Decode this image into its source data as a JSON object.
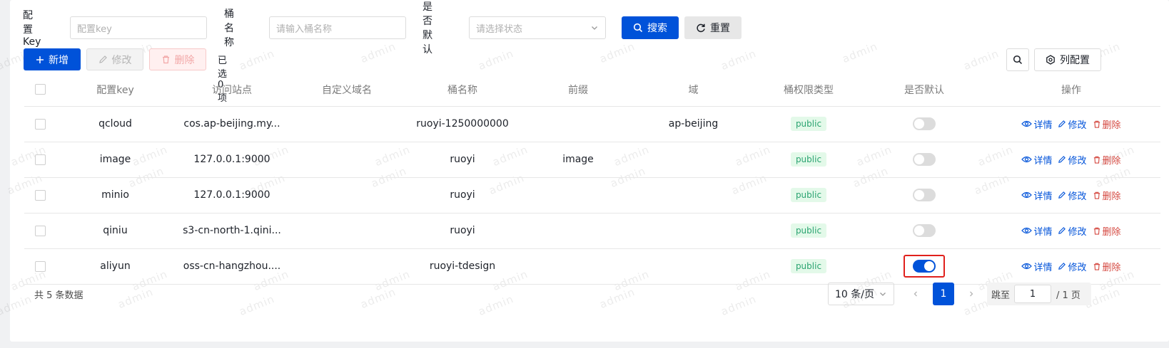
{
  "search": {
    "key_label": "配置Key",
    "key_placeholder": "配置key",
    "bucket_label": "桶名称",
    "bucket_placeholder": "请输入桶名称",
    "default_label": "是否默认",
    "default_placeholder": "请选择状态",
    "search_btn": "搜索",
    "reset_btn": "重置"
  },
  "toolbar": {
    "add_btn": "新增",
    "edit_btn": "修改",
    "delete_btn": "删除",
    "selected_text": "已选 0 项",
    "column_config_btn": "列配置"
  },
  "table": {
    "headers": [
      "配置key",
      "访问站点",
      "自定义域名",
      "桶名称",
      "前缀",
      "域",
      "桶权限类型",
      "是否默认",
      "操作"
    ],
    "rows": [
      {
        "key": "qcloud",
        "endpoint": "cos.ap-beijing.my...",
        "domain": "",
        "bucket": "ruoyi-1250000000",
        "prefix": "",
        "region": "ap-beijing",
        "access": "public",
        "is_default": false
      },
      {
        "key": "image",
        "endpoint": "127.0.0.1:9000",
        "domain": "",
        "bucket": "ruoyi",
        "prefix": "image",
        "region": "",
        "access": "public",
        "is_default": false
      },
      {
        "key": "minio",
        "endpoint": "127.0.0.1:9000",
        "domain": "",
        "bucket": "ruoyi",
        "prefix": "",
        "region": "",
        "access": "public",
        "is_default": false
      },
      {
        "key": "qiniu",
        "endpoint": "s3-cn-north-1.qini...",
        "domain": "",
        "bucket": "ruoyi",
        "prefix": "",
        "region": "",
        "access": "public",
        "is_default": false
      },
      {
        "key": "aliyun",
        "endpoint": "oss-cn-hangzhou....",
        "domain": "",
        "bucket": "ruoyi-tdesign",
        "prefix": "",
        "region": "",
        "access": "public",
        "is_default": true
      }
    ],
    "actions": {
      "detail": "详情",
      "edit": "修改",
      "delete": "删除"
    }
  },
  "footer": {
    "total_text": "共 5 条数据",
    "page_size": "10 条/页",
    "current_page": "1",
    "jump_label": "跳至",
    "jump_value": "1",
    "total_pages": "/ 1 页"
  },
  "watermark": "admin",
  "colors": {
    "primary": "#0052d9",
    "danger": "#d54941",
    "success": "#2ba471",
    "highlight": "#e0201c"
  }
}
